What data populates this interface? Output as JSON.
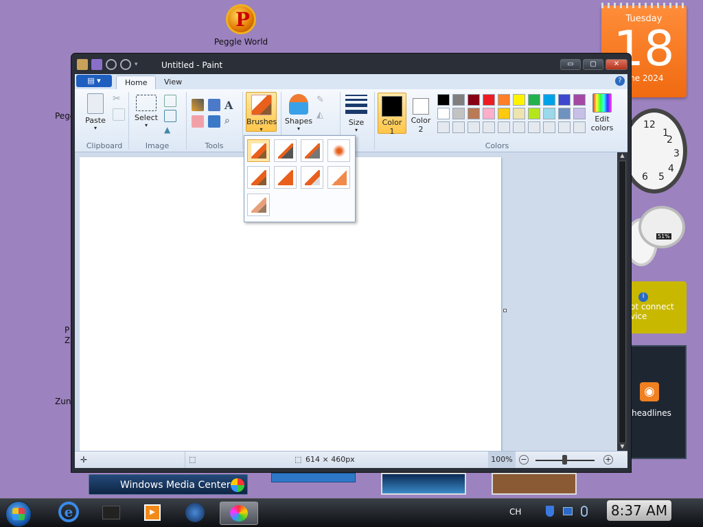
{
  "desktop": {
    "icons": [
      {
        "label": "Peggle World"
      },
      {
        "label": "Pegg"
      },
      {
        "label": "P"
      },
      {
        "label": "Z"
      },
      {
        "label": "Zun"
      }
    ]
  },
  "gadgets": {
    "calendar": {
      "weekday": "Tuesday",
      "day": "18",
      "month_year": "une 2024"
    },
    "clock_numbers": [
      "12",
      "1",
      "2",
      "3",
      "4",
      "5",
      "6"
    ],
    "meter_text": "51%",
    "weather_text": [
      "ot connect",
      "vice"
    ],
    "feed_text": "headlines"
  },
  "paint": {
    "title": "Untitled - Paint",
    "window_buttons": {
      "minimize": "▭",
      "maximize": "▢",
      "close": "✕"
    },
    "tabs": [
      "Home",
      "View"
    ],
    "help": "?",
    "groups": {
      "clipboard": "Clipboard",
      "image": "Image",
      "tools": "Tools",
      "colors": "Colors"
    },
    "buttons": {
      "paste": "Paste",
      "select": "Select",
      "brushes": "Brushes",
      "shapes": "Shapes",
      "size": "Size",
      "color1": "Color\n1",
      "color1_a": "Color",
      "color1_b": "1",
      "color2_a": "Color",
      "color2_b": "2",
      "edit_colors_a": "Edit",
      "edit_colors_b": "colors"
    },
    "active_colors": {
      "color1": "#000000",
      "color2": "#ffffff"
    },
    "palette": [
      "#000000",
      "#7f7f7f",
      "#880015",
      "#ed1c24",
      "#ff7f27",
      "#fff200",
      "#22b14c",
      "#00a2e8",
      "#3f48cc",
      "#a349a4",
      "#ffffff",
      "#c3c3c3",
      "#b97a57",
      "#ffaec9",
      "#ffc90e",
      "#efe4b0",
      "#b5e61d",
      "#99d9ea",
      "#7092be",
      "#c8bfe7",
      "#e4e9f0",
      "#e4e9f0",
      "#e4e9f0",
      "#e4e9f0",
      "#e4e9f0",
      "#e4e9f0",
      "#e4e9f0",
      "#e4e9f0",
      "#e4e9f0",
      "#e4e9f0"
    ],
    "brushes_menu": [
      "brush",
      "calligraphy-brush-1",
      "calligraphy-brush-2",
      "airbrush",
      "oil-brush",
      "crayon",
      "marker",
      "natural-pencil",
      "watercolor-brush"
    ],
    "status": {
      "dimensions": "614 × 460px",
      "zoom": "100%"
    }
  },
  "taskbar": {
    "wmc": "Windows Media Center",
    "lang": "CH",
    "time": "8:37 AM"
  }
}
